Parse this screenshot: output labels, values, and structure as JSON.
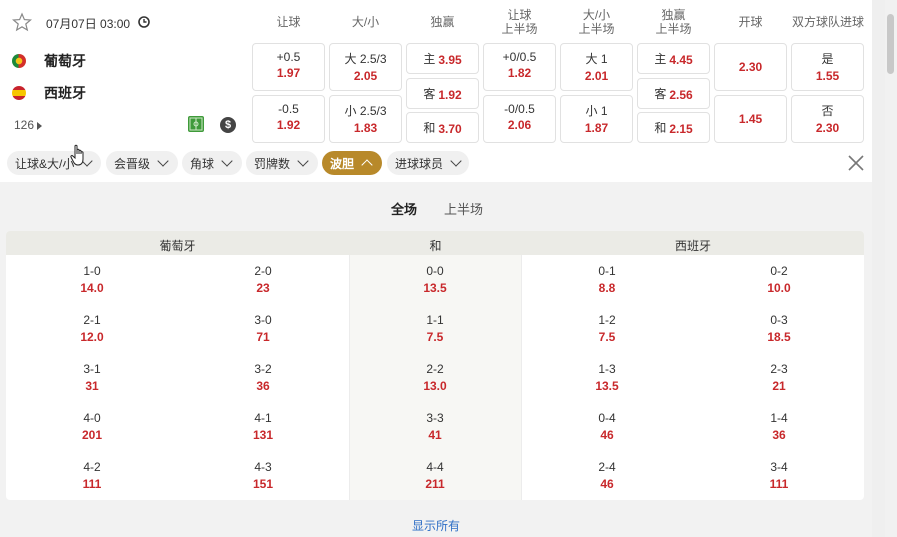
{
  "match": {
    "datetime": "07月07日 03:00",
    "home": "葡萄牙",
    "away": "西班牙",
    "more_count": "126"
  },
  "colors": {
    "odds_red": "#c8282b",
    "accent_gold": "#b8892a",
    "link_blue": "#2f6fc6"
  },
  "icons": [
    "star-icon",
    "clock-icon",
    "flag-portugal-icon",
    "flag-spain-icon",
    "pitch-icon",
    "money-icon",
    "close-icon",
    "chevron-down-icon",
    "chevron-up-icon"
  ],
  "headers": {
    "handicap": "让球",
    "over_under": "大/小",
    "moneyline": "独赢",
    "handicap_h1_a": "让球",
    "handicap_h1_b": "上半场",
    "ou_h1_a": "大/小",
    "ou_h1_b": "上半场",
    "ml_h1_a": "独赢",
    "ml_h1_b": "上半场",
    "kickoff": "开球",
    "btts": "双方球队进球"
  },
  "odds": {
    "handicap": [
      {
        "line": "+0.5",
        "value": "1.97"
      },
      {
        "line": "-0.5",
        "value": "1.92"
      }
    ],
    "over_under": [
      {
        "line": "大 2.5/3",
        "value": "2.05"
      },
      {
        "line": "小 2.5/3",
        "value": "1.83"
      }
    ],
    "moneyline": [
      {
        "label": "主",
        "value": "3.95"
      },
      {
        "label": "客",
        "value": "1.92"
      },
      {
        "label": "和",
        "value": "3.70"
      }
    ],
    "handicap_h1": [
      {
        "line": "+0/0.5",
        "value": "1.82"
      },
      {
        "line": "-0/0.5",
        "value": "2.06"
      }
    ],
    "ou_h1": [
      {
        "line": "大 1",
        "value": "2.01"
      },
      {
        "line": "小 1",
        "value": "1.87"
      }
    ],
    "ml_h1": [
      {
        "label": "主",
        "value": "4.45"
      },
      {
        "label": "客",
        "value": "2.56"
      },
      {
        "label": "和",
        "value": "2.15"
      }
    ],
    "kickoff": [
      {
        "value": "2.30"
      },
      {
        "value": "1.45"
      }
    ],
    "btts": [
      {
        "label": "是",
        "value": "1.55"
      },
      {
        "label": "否",
        "value": "2.30"
      }
    ]
  },
  "filters": [
    {
      "label": "让球&大/小",
      "active": false
    },
    {
      "label": "会晋级",
      "active": false
    },
    {
      "label": "角球",
      "active": false
    },
    {
      "label": "罚牌数",
      "active": false
    },
    {
      "label": "波胆",
      "active": true
    },
    {
      "label": "进球球员",
      "active": false
    }
  ],
  "tabs": [
    {
      "label": "全场",
      "active": true
    },
    {
      "label": "上半场",
      "active": false
    }
  ],
  "correct_score": {
    "col_home": "葡萄牙",
    "col_draw": "和",
    "col_away": "西班牙",
    "rows": [
      [
        {
          "s": "1-0",
          "o": "14.0"
        },
        {
          "s": "2-0",
          "o": "23"
        },
        {
          "s": "0-0",
          "o": "13.5"
        },
        {
          "s": "0-1",
          "o": "8.8"
        },
        {
          "s": "0-2",
          "o": "10.0"
        }
      ],
      [
        {
          "s": "2-1",
          "o": "12.0"
        },
        {
          "s": "3-0",
          "o": "71"
        },
        {
          "s": "1-1",
          "o": "7.5"
        },
        {
          "s": "1-2",
          "o": "7.5"
        },
        {
          "s": "0-3",
          "o": "18.5"
        }
      ],
      [
        {
          "s": "3-1",
          "o": "31"
        },
        {
          "s": "3-2",
          "o": "36"
        },
        {
          "s": "2-2",
          "o": "13.0"
        },
        {
          "s": "1-3",
          "o": "13.5"
        },
        {
          "s": "2-3",
          "o": "21"
        }
      ],
      [
        {
          "s": "4-0",
          "o": "201"
        },
        {
          "s": "4-1",
          "o": "131"
        },
        {
          "s": "3-3",
          "o": "41"
        },
        {
          "s": "0-4",
          "o": "46"
        },
        {
          "s": "1-4",
          "o": "36"
        }
      ],
      [
        {
          "s": "4-2",
          "o": "111"
        },
        {
          "s": "4-3",
          "o": "151"
        },
        {
          "s": "4-4",
          "o": "211"
        },
        {
          "s": "2-4",
          "o": "46"
        },
        {
          "s": "3-4",
          "o": "111"
        }
      ]
    ]
  },
  "show_all": "显示所有"
}
